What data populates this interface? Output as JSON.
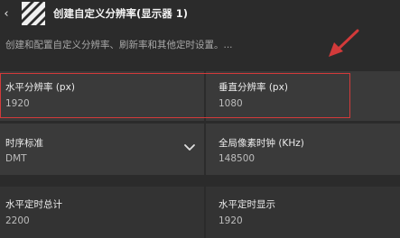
{
  "header": {
    "title": "创建自定义分辨率(显示器 1)",
    "back_icon": "chevron-left-icon",
    "app_icon": "striped-logo-icon"
  },
  "description": "创建和配置自定义分辨率、刷新率和其他定时设置。...",
  "fields": {
    "h_res": {
      "label": "水平分辨率 (px)",
      "value": "1920"
    },
    "v_res": {
      "label": "垂直分辨率 (px)",
      "value": "1080"
    },
    "timing": {
      "label": "时序标准",
      "value": "DMT"
    },
    "pixel_clock": {
      "label": "全局像素时钟 (KHz)",
      "value": "148500"
    },
    "h_total": {
      "label": "水平定时总计",
      "value": "2200"
    },
    "h_display": {
      "label": "水平定时显示",
      "value": "1920"
    }
  },
  "colors": {
    "highlight": "#d23a3a",
    "arrow": "#d23a3a",
    "background": "#2b2b2b"
  }
}
